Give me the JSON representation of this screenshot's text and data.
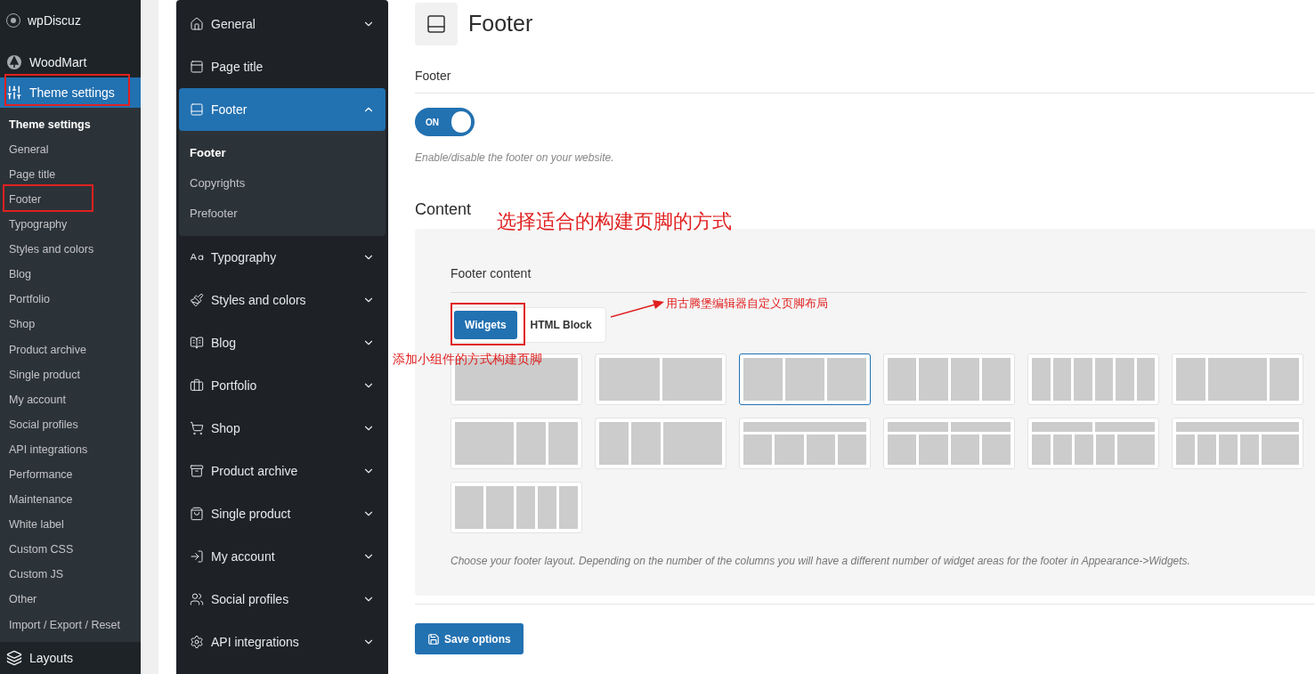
{
  "admin_menu": {
    "top_items": [
      {
        "label": "wpDiscuz",
        "selected": false
      },
      {
        "label": "WoodMart",
        "selected": false
      },
      {
        "label": "Theme settings",
        "selected": true
      }
    ],
    "submenu": [
      {
        "label": "Theme settings",
        "selected": true
      },
      {
        "label": "General",
        "selected": false
      },
      {
        "label": "Page title",
        "selected": false
      },
      {
        "label": "Footer",
        "selected": false
      },
      {
        "label": "Typography",
        "selected": false
      },
      {
        "label": "Styles and colors",
        "selected": false
      },
      {
        "label": "Blog",
        "selected": false
      },
      {
        "label": "Portfolio",
        "selected": false
      },
      {
        "label": "Shop",
        "selected": false
      },
      {
        "label": "Product archive",
        "selected": false
      },
      {
        "label": "Single product",
        "selected": false
      },
      {
        "label": "My account",
        "selected": false
      },
      {
        "label": "Social profiles",
        "selected": false
      },
      {
        "label": "API integrations",
        "selected": false
      },
      {
        "label": "Performance",
        "selected": false
      },
      {
        "label": "Maintenance",
        "selected": false
      },
      {
        "label": "White label",
        "selected": false
      },
      {
        "label": "Custom CSS",
        "selected": false
      },
      {
        "label": "Custom JS",
        "selected": false
      },
      {
        "label": "Other",
        "selected": false
      },
      {
        "label": "Import / Export / Reset",
        "selected": false
      }
    ],
    "bottom_item": {
      "label": "Layouts",
      "selected": false
    }
  },
  "settings_nav": [
    {
      "label": "General",
      "selected": false,
      "expanded": false
    },
    {
      "label": "Page title",
      "selected": false,
      "expanded": false
    },
    {
      "label": "Footer",
      "selected": true,
      "expanded": true,
      "children": [
        {
          "label": "Footer",
          "selected": true
        },
        {
          "label": "Copyrights",
          "selected": false
        },
        {
          "label": "Prefooter",
          "selected": false
        }
      ]
    },
    {
      "label": "Typography",
      "selected": false,
      "expanded": false
    },
    {
      "label": "Styles and colors",
      "selected": false,
      "expanded": false
    },
    {
      "label": "Blog",
      "selected": false,
      "expanded": false
    },
    {
      "label": "Portfolio",
      "selected": false,
      "expanded": false
    },
    {
      "label": "Shop",
      "selected": false,
      "expanded": false
    },
    {
      "label": "Product archive",
      "selected": false,
      "expanded": false
    },
    {
      "label": "Single product",
      "selected": false,
      "expanded": false
    },
    {
      "label": "My account",
      "selected": false,
      "expanded": false
    },
    {
      "label": "Social profiles",
      "selected": false,
      "expanded": false
    },
    {
      "label": "API integrations",
      "selected": false,
      "expanded": false
    }
  ],
  "page": {
    "title": "Footer",
    "footer_option": {
      "label": "Footer",
      "toggle": {
        "on": true,
        "text": "ON"
      },
      "hint": "Enable/disable the footer on your website."
    },
    "content": {
      "heading": "Content",
      "field_label": "Footer content",
      "tabs": [
        {
          "label": "Widgets",
          "selected": true
        },
        {
          "label": "HTML Block",
          "selected": false
        }
      ],
      "layouts": [
        {
          "kind": "single",
          "selected": false
        },
        {
          "kind": "halves",
          "selected": false
        },
        {
          "kind": "thirds",
          "selected": true
        },
        {
          "kind": "quarters",
          "selected": false
        },
        {
          "kind": "sixths",
          "selected": false
        },
        {
          "kind": "wide-center",
          "selected": false
        },
        {
          "kind": "wide-left",
          "selected": false
        },
        {
          "kind": "wide-right",
          "selected": false
        },
        {
          "kind": "top-quarters",
          "selected": false
        },
        {
          "kind": "split-quarters",
          "selected": false
        },
        {
          "kind": "split-mixed",
          "selected": false
        },
        {
          "kind": "top-mixed",
          "selected": false
        },
        {
          "kind": "fifths",
          "selected": false
        }
      ],
      "description": "Choose your footer layout. Depending on the number of the columns you will have a different number of widget areas for the footer in Appearance->Widgets."
    },
    "save_button": "Save options"
  },
  "annotations": {
    "main_note": "选择适合的构建页脚的方式",
    "html_note": "用古腾堡编辑器自定义页脚布局",
    "widgets_note": "添加小组件的方式构建页脚"
  }
}
